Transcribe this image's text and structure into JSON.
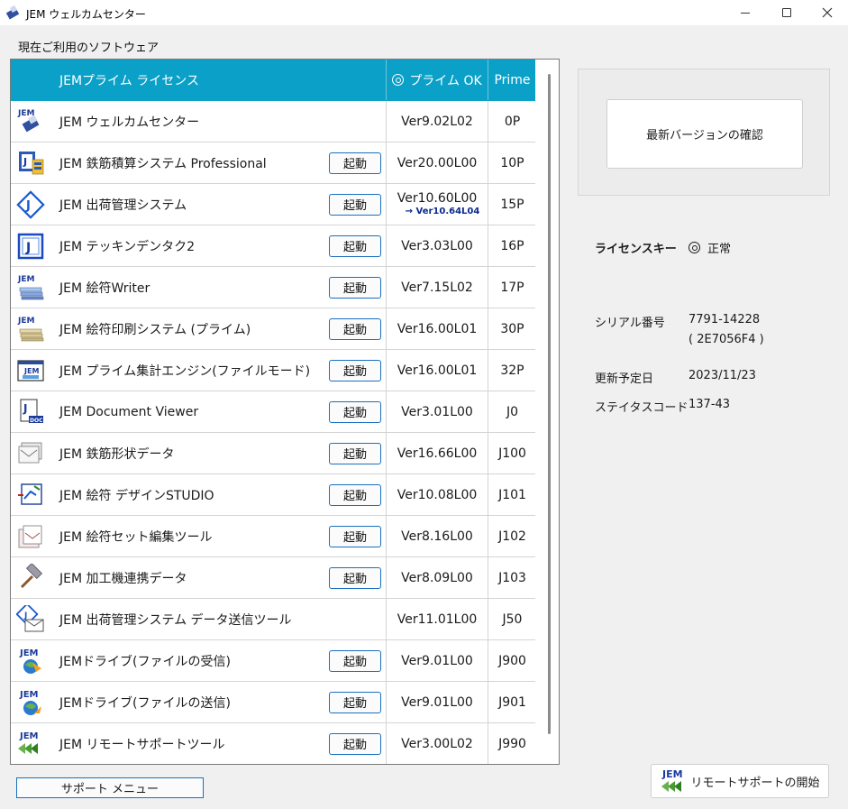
{
  "window": {
    "title": "JEM ウェルカムセンター"
  },
  "section_label": "現在ご利用のソフトウェア",
  "header": {
    "name": "JEMプライム ライセンス",
    "status": "プライム OK",
    "code": "Prime"
  },
  "launch_label": "起動",
  "rows": [
    {
      "icon": "jem-welcome-icon",
      "name": "JEM ウェルカムセンター",
      "launch": false,
      "version": "Ver9.02L02",
      "update": "",
      "code": "0P"
    },
    {
      "icon": "rebar-estimate-icon",
      "name": "JEM 鉄筋積算システム Professional",
      "launch": true,
      "version": "Ver20.00L00",
      "update": "",
      "code": "10P"
    },
    {
      "icon": "shipping-icon",
      "name": "JEM 出荷管理システム",
      "launch": true,
      "version": "Ver10.60L00",
      "update": "→ Ver10.64L04",
      "code": "15P"
    },
    {
      "icon": "tekkin-dentaku-icon",
      "name": "JEM テッキンデンタク2",
      "launch": true,
      "version": "Ver3.03L00",
      "update": "",
      "code": "16P"
    },
    {
      "icon": "efu-writer-icon",
      "name": "JEM 絵符Writer",
      "launch": true,
      "version": "Ver7.15L02",
      "update": "",
      "code": "17P"
    },
    {
      "icon": "efu-print-icon",
      "name": "JEM 絵符印刷システム (プライム)",
      "launch": true,
      "version": "Ver16.00L01",
      "update": "",
      "code": "30P"
    },
    {
      "icon": "aggregation-engine-icon",
      "name": "JEM プライム集計エンジン(ファイルモード)",
      "launch": true,
      "version": "Ver16.00L01",
      "update": "",
      "code": "32P"
    },
    {
      "icon": "document-viewer-icon",
      "name": "JEM Document Viewer",
      "launch": true,
      "version": "Ver3.01L00",
      "update": "",
      "code": "J0"
    },
    {
      "icon": "rebar-shape-icon",
      "name": "JEM 鉄筋形状データ",
      "launch": true,
      "version": "Ver16.66L00",
      "update": "",
      "code": "J100"
    },
    {
      "icon": "design-studio-icon",
      "name": "JEM 絵符 デザインSTUDIO",
      "launch": true,
      "version": "Ver10.08L00",
      "update": "",
      "code": "J101"
    },
    {
      "icon": "set-editor-icon",
      "name": "JEM 絵符セット編集ツール",
      "launch": true,
      "version": "Ver8.16L00",
      "update": "",
      "code": "J102"
    },
    {
      "icon": "machine-link-icon",
      "name": "JEM 加工機連携データ",
      "launch": true,
      "version": "Ver8.09L00",
      "update": "",
      "code": "J103"
    },
    {
      "icon": "data-send-icon",
      "name": "JEM 出荷管理システム データ送信ツール",
      "launch": false,
      "version": "Ver11.01L00",
      "update": "",
      "code": "J50"
    },
    {
      "icon": "drive-receive-icon",
      "name": "JEMドライブ(ファイルの受信)",
      "launch": true,
      "version": "Ver9.01L00",
      "update": "",
      "code": "J900"
    },
    {
      "icon": "drive-send-icon",
      "name": "JEMドライブ(ファイルの送信)",
      "launch": true,
      "version": "Ver9.01L00",
      "update": "",
      "code": "J901"
    },
    {
      "icon": "remote-support-icon",
      "name": "JEM リモートサポートツール",
      "launch": true,
      "version": "Ver3.00L02",
      "update": "",
      "code": "J990"
    }
  ],
  "side": {
    "check_version": "最新バージョンの確認",
    "license_key_label": "ライセンスキー",
    "license_status": "正常",
    "serial_label": "シリアル番号",
    "serial_value": "7791-14228",
    "serial_sub": "( 2E7056F4 )",
    "renewal_label": "更新予定日",
    "renewal_value": "2023/11/23",
    "status_code_label": "ステイタスコード",
    "status_code_value": "137-43"
  },
  "footer": {
    "support_menu": "サポート メニュー",
    "remote_support": "リモートサポートの開始"
  },
  "colors": {
    "header_bg": "#0aa0c8",
    "accent_border": "#1a6fbf",
    "update_text": "#0b2a8c"
  }
}
